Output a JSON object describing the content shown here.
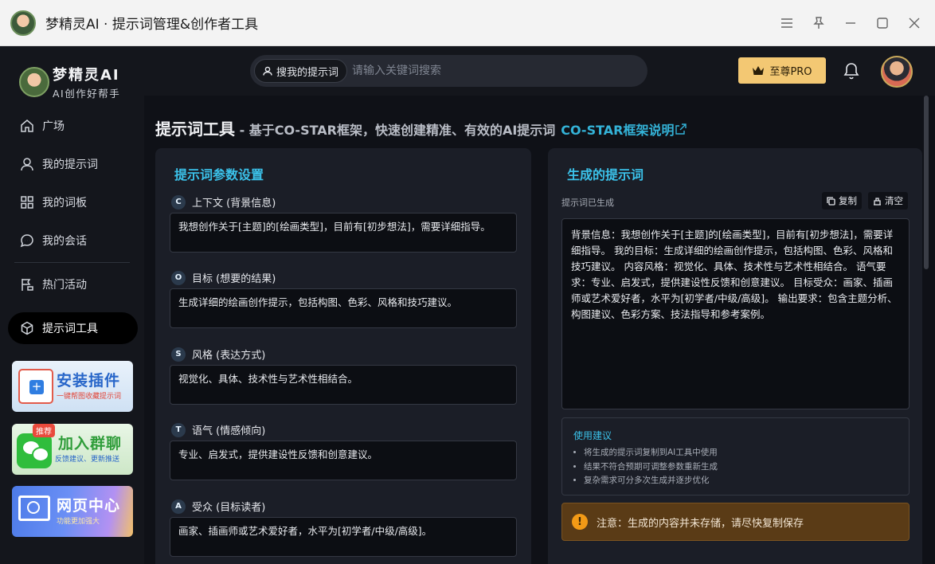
{
  "window": {
    "title": "梦精灵AI · 提示词管理&创作者工具",
    "controls": [
      "menu-icon",
      "pin-icon",
      "minimize-icon",
      "maximize-icon",
      "close-icon"
    ]
  },
  "brand": {
    "name": "梦精灵AI",
    "subtitle": "AI创作好帮手"
  },
  "sidebar": {
    "items": [
      {
        "label": "广场",
        "icon": "home-icon"
      },
      {
        "label": "我的提示词",
        "icon": "user-icon"
      },
      {
        "label": "我的词板",
        "icon": "grid-icon"
      },
      {
        "label": "我的会话",
        "icon": "chat-icon"
      },
      {
        "label": "热门活动",
        "icon": "flag-icon"
      },
      {
        "label": "提示词工具",
        "icon": "cube-icon",
        "active": true
      }
    ],
    "promos": [
      {
        "title": "安装插件",
        "subtitle": "一键帮图收藏提示词"
      },
      {
        "title": "加入群聊",
        "subtitle": "反馈建议、更新推送",
        "badge": "推荐"
      },
      {
        "title": "网页中心",
        "subtitle": "功能更加强大"
      }
    ]
  },
  "header": {
    "search_chip": "搜我的提示词",
    "search_placeholder": "请输入关键词搜索",
    "pro_label": "至尊PRO"
  },
  "page": {
    "title": "提示词工具",
    "dash": " - ",
    "subtitle": "基于CO-STAR框架，快速创建精准、有效的AI提示词",
    "link": "CO-STAR框架说明"
  },
  "params": {
    "heading": "提示词参数设置",
    "fields": [
      {
        "letter": "C",
        "label": "上下文 (背景信息)",
        "value": "我想创作关于[主题]的[绘画类型]，目前有[初步想法]，需要详细指导。"
      },
      {
        "letter": "O",
        "label": "目标 (想要的结果)",
        "value": "生成详细的绘画创作提示，包括构图、色彩、风格和技巧建议。"
      },
      {
        "letter": "S",
        "label": "风格 (表达方式)",
        "value": "视觉化、具体、技术性与艺术性相结合。"
      },
      {
        "letter": "T",
        "label": "语气 (情感倾向)",
        "value": "专业、启发式，提供建设性反馈和创意建议。"
      },
      {
        "letter": "A",
        "label": "受众 (目标读者)",
        "value": "画家、插画师或艺术爱好者，水平为[初学者/中级/高级]。"
      }
    ]
  },
  "output": {
    "heading": "生成的提示词",
    "status": "提示词已生成",
    "copy_label": "复制",
    "clear_label": "清空",
    "text": "背景信息：我想创作关于[主题]的[绘画类型]，目前有[初步想法]，需要详细指导。  我的目标：生成详细的绘画创作提示，包括构图、色彩、风格和技巧建议。  内容风格：视觉化、具体、技术性与艺术性相结合。  语气要求：专业、启发式，提供建设性反馈和创意建议。  目标受众：画家、插画师或艺术爱好者，水平为[初学者/中级/高级]。  输出要求：包含主题分析、构图建议、色彩方案、技法指导和参考案例。",
    "tips_title": "使用建议",
    "tips": [
      "将生成的提示词复制到AI工具中使用",
      "结果不符合预期可调整参数重新生成",
      "复杂需求可分多次生成并逐步优化"
    ],
    "warning": "注意：生成的内容并未存储，请尽快复制保存"
  }
}
